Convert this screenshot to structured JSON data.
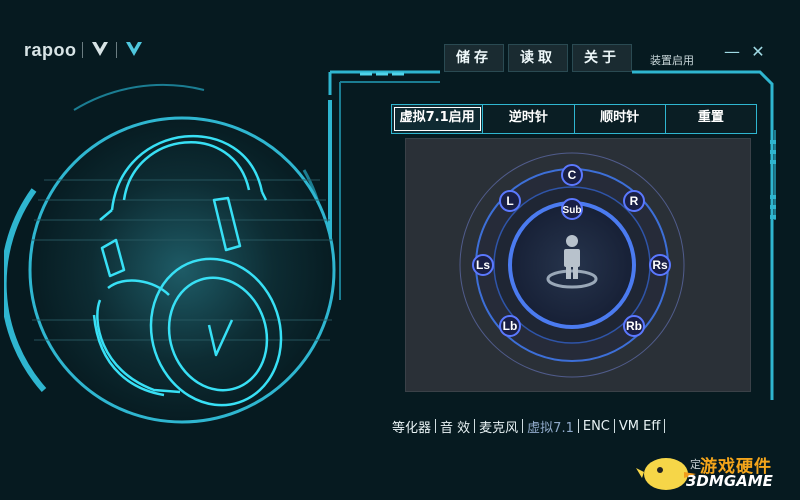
{
  "brand": {
    "logo_text": "rapoo",
    "mark": "V"
  },
  "toolbar": {
    "save": "储存",
    "load": "读取",
    "about": "关于",
    "device_label": "装置启用"
  },
  "window": {
    "minimize": "—",
    "close": "✕"
  },
  "tabs": [
    {
      "label": "虚拟7.1启用",
      "active": true
    },
    {
      "label": "逆时针",
      "active": false
    },
    {
      "label": "顺时针",
      "active": false
    },
    {
      "label": "重置",
      "active": false
    }
  ],
  "speakers": {
    "c": "C",
    "l": "L",
    "r": "R",
    "sub": "Sub",
    "ls": "Ls",
    "rs": "Rs",
    "lb": "Lb",
    "rb": "Rb"
  },
  "listener_icon": "person-on-platform-icon",
  "nav": [
    {
      "label": "等化器",
      "active": false
    },
    {
      "label": "音  效",
      "active": false
    },
    {
      "label": "麦克风",
      "active": false
    },
    {
      "label": "虚拟7.1",
      "active": true
    },
    {
      "label": "ENC",
      "active": false
    },
    {
      "label": "VM Eff",
      "active": false
    }
  ],
  "watermark": {
    "line1": "游戏硬件",
    "line2": "3DMGAME",
    "obscured": "定"
  },
  "colors": {
    "accent": "#2fb6d0",
    "background": "#061a20",
    "ring": "#3a74e6",
    "panel": "#2a3037"
  }
}
